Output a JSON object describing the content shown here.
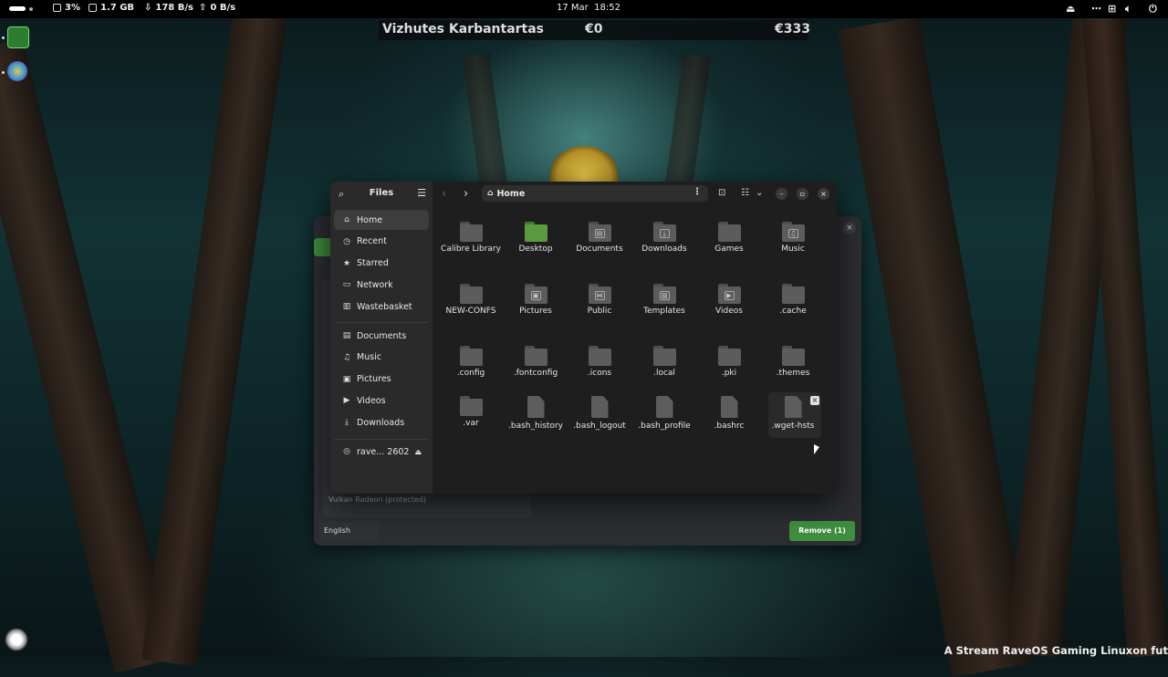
{
  "topbar": {
    "cpu": "3%",
    "memory": "1.7 GB",
    "download": "178 B/s",
    "upload": "0 B/s",
    "datetime": "17 Mar  18:52"
  },
  "stream_overlay": {
    "name": "Vizhutes Karbantartas",
    "amount_left": "€0",
    "amount_right": "€333"
  },
  "background_window": {
    "device": "Vulkan Radeon (protected)",
    "language": "English",
    "remove_label": "Remove (1)",
    "close": "×"
  },
  "files": {
    "title": "Files",
    "path": "Home",
    "sidebar": {
      "places": [
        {
          "label": "Home",
          "icon": "⌂",
          "active": true
        },
        {
          "label": "Recent",
          "icon": "◷"
        },
        {
          "label": "Starred",
          "icon": "★"
        },
        {
          "label": "Network",
          "icon": "▭"
        },
        {
          "label": "Wastebasket",
          "icon": "▥"
        }
      ],
      "bookmarks": [
        {
          "label": "Documents",
          "icon": "▤"
        },
        {
          "label": "Music",
          "icon": "♫"
        },
        {
          "label": "Pictures",
          "icon": "▣"
        },
        {
          "label": "Videos",
          "icon": "▶"
        },
        {
          "label": "Downloads",
          "icon": "⤓"
        }
      ],
      "device": {
        "label": "rave... 2602",
        "icon": "◎",
        "eject": "⏏"
      }
    },
    "items": [
      {
        "label": "Calibre Library",
        "kind": "folder"
      },
      {
        "label": "Desktop",
        "kind": "folder-green"
      },
      {
        "label": "Documents",
        "kind": "folder",
        "emblem": "▤"
      },
      {
        "label": "Downloads",
        "kind": "folder",
        "emblem": "⤓"
      },
      {
        "label": "Games",
        "kind": "folder"
      },
      {
        "label": "Music",
        "kind": "folder",
        "emblem": "♫"
      },
      {
        "label": "NEW-CONFS",
        "kind": "folder"
      },
      {
        "label": "Pictures",
        "kind": "folder",
        "emblem": "▣"
      },
      {
        "label": "Public",
        "kind": "folder",
        "emblem": "⋈"
      },
      {
        "label": "Templates",
        "kind": "folder",
        "emblem": "▧"
      },
      {
        "label": "Videos",
        "kind": "folder",
        "emblem": "▶"
      },
      {
        "label": ".cache",
        "kind": "folder"
      },
      {
        "label": ".config",
        "kind": "folder"
      },
      {
        "label": ".fontconfig",
        "kind": "folder"
      },
      {
        "label": ".icons",
        "kind": "folder"
      },
      {
        "label": ".local",
        "kind": "folder"
      },
      {
        "label": ".pki",
        "kind": "folder"
      },
      {
        "label": ".themes",
        "kind": "folder"
      },
      {
        "label": ".var",
        "kind": "folder"
      },
      {
        "label": ".bash_history",
        "kind": "file"
      },
      {
        "label": ".bash_logout",
        "kind": "file"
      },
      {
        "label": ".bash_profile",
        "kind": "file"
      },
      {
        "label": ".bashrc",
        "kind": "file"
      },
      {
        "label": ".wget-hsts",
        "kind": "file",
        "selected": true
      }
    ]
  },
  "stream_footer": "A Stream RaveOS Gaming Linuxon fut",
  "colors": {
    "accent_green": "#3f8d3f",
    "folder": "#5c5c5c",
    "window_bg": "#1e1e1e",
    "sidebar_bg": "#2a2a2a"
  }
}
